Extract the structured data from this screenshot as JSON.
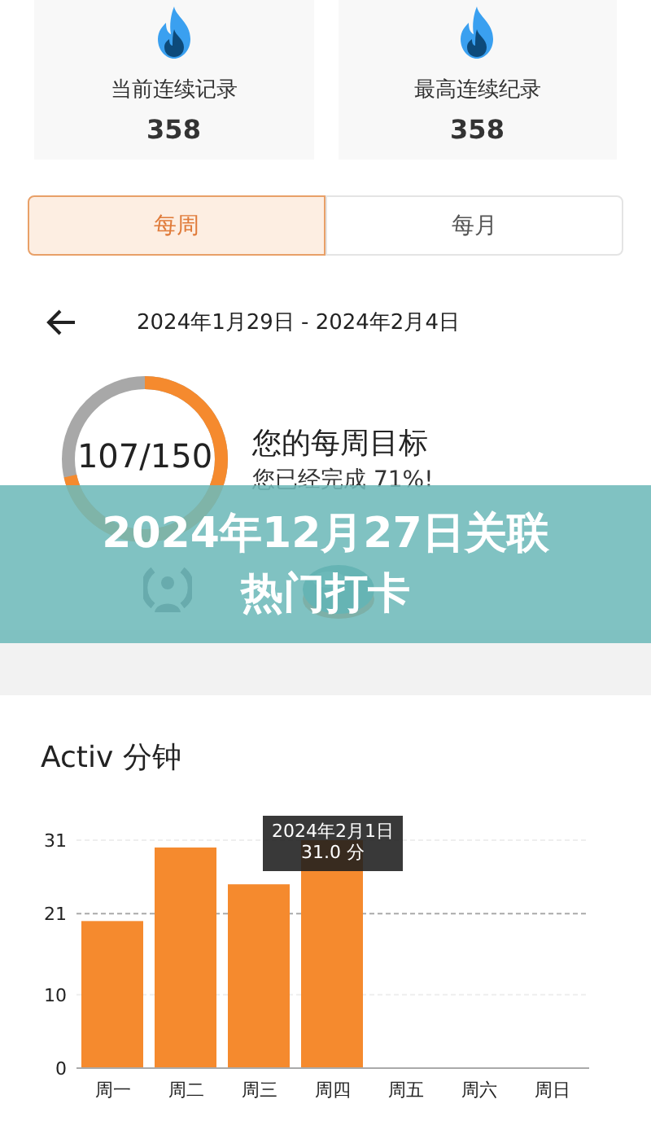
{
  "stats": [
    {
      "label": "当前连续记录",
      "value": "358"
    },
    {
      "label": "最高连续纪录",
      "value": "358"
    }
  ],
  "tabs": [
    {
      "label": "每周",
      "selected": true
    },
    {
      "label": "每月",
      "selected": false
    }
  ],
  "period": {
    "range": "2024年1月29日 - 2024年2月4日"
  },
  "goal": {
    "progress": "107/150",
    "title": "您的每周目标",
    "subtitle": "您已经完成 71%!"
  },
  "activity": {
    "chart_data": {
      "type": "bar",
      "title": "Activ 分钟",
      "categories": [
        "周一",
        "周二",
        "周三",
        "周四",
        "周五",
        "周六",
        "周日"
      ],
      "series": [
        {
          "color": "#f58a2e",
          "values": [
            20,
            30,
            25,
            31,
            0,
            0,
            0
          ]
        }
      ],
      "ylim": [
        0,
        31
      ],
      "yticks": [
        0,
        10,
        21,
        31
      ]
    },
    "tooltip": {
      "date": "2024年2月1日",
      "value": "31.0 分"
    }
  },
  "banner": {
    "text": "2024年12月27日关联热门打卡"
  }
}
